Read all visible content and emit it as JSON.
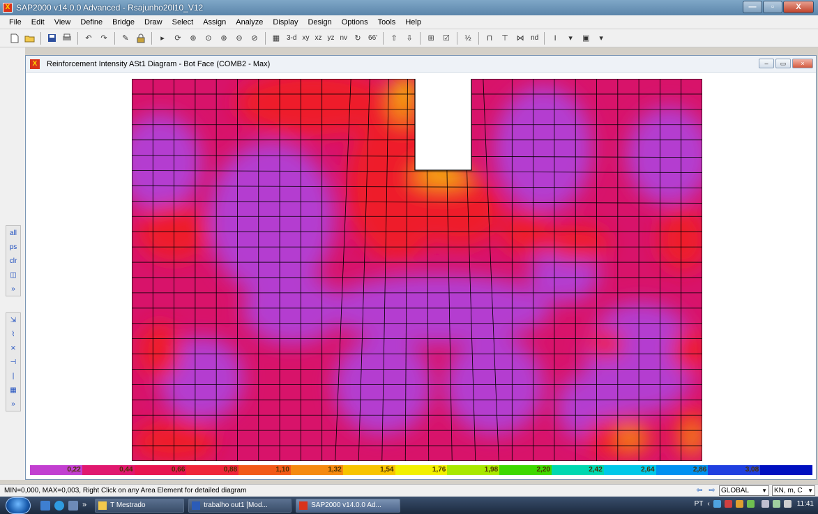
{
  "app": {
    "title": "SAP2000 v14.0.0 Advanced  - Rsajunho20l10_V12",
    "logo": "X",
    "minimize_glyph": "—",
    "maximize_glyph": "▫",
    "close_glyph": "X"
  },
  "menu": [
    "File",
    "Edit",
    "View",
    "Define",
    "Bridge",
    "Draw",
    "Select",
    "Assign",
    "Analyze",
    "Display",
    "Design",
    "Options",
    "Tools",
    "Help"
  ],
  "toolbar": {
    "view_3d": "3-d",
    "view_xy": "xy",
    "view_xz": "xz",
    "view_yz": "yz",
    "view_nv": "nv",
    "view_66": "66'",
    "nd_label": "nd"
  },
  "leftpanel": {
    "select_items": [
      "all",
      "ps",
      "clr",
      "◫",
      "»"
    ],
    "snap_items": [
      "⇲",
      "⌇",
      "⨯",
      "⊣",
      "|",
      "▦",
      "»"
    ]
  },
  "child_window": {
    "title": "Reinforcement Intensity ASt1 Diagram - Bot Face  (COMB2 - Max)",
    "logo": "X",
    "min_glyph": "–",
    "max_glyph": "▭",
    "close_glyph": "×"
  },
  "legend": {
    "labels": [
      "0,22",
      "0,44",
      "0,66",
      "0,88",
      "1,10",
      "1,32",
      "1,54",
      "1,76",
      "1,98",
      "2,20",
      "2,42",
      "2,64",
      "2,86",
      "3,08",
      ""
    ],
    "colors": [
      "#c23fd0",
      "#e0186f",
      "#e81550",
      "#f0263a",
      "#f25a18",
      "#f58a10",
      "#f8c400",
      "#f2f000",
      "#a8e800",
      "#3ed800",
      "#00d8b0",
      "#00c8e8",
      "#0090f0",
      "#2040e0",
      "#0010c0"
    ]
  },
  "status": {
    "text": "MIN=0,000, MAX=0,003, Right Click on any Area Element for detailed diagram",
    "coord_system": "GLOBAL",
    "units": "KN, m, C",
    "left_arrow": "⇦",
    "right_arrow": "⇨"
  },
  "taskbar": {
    "overflow": "»",
    "buttons": [
      "T Mestrado",
      "trabalho out1 [Mod...",
      "SAP2000 v14.0.0 Ad..."
    ],
    "language": "PT",
    "time": "11:41"
  },
  "colors": {
    "field_magenta": "#d8136a",
    "field_red": "#ee1c2b",
    "field_purple": "#b43cd0",
    "field_orange": "#f58a10",
    "field_yellow": "#f8d000"
  }
}
